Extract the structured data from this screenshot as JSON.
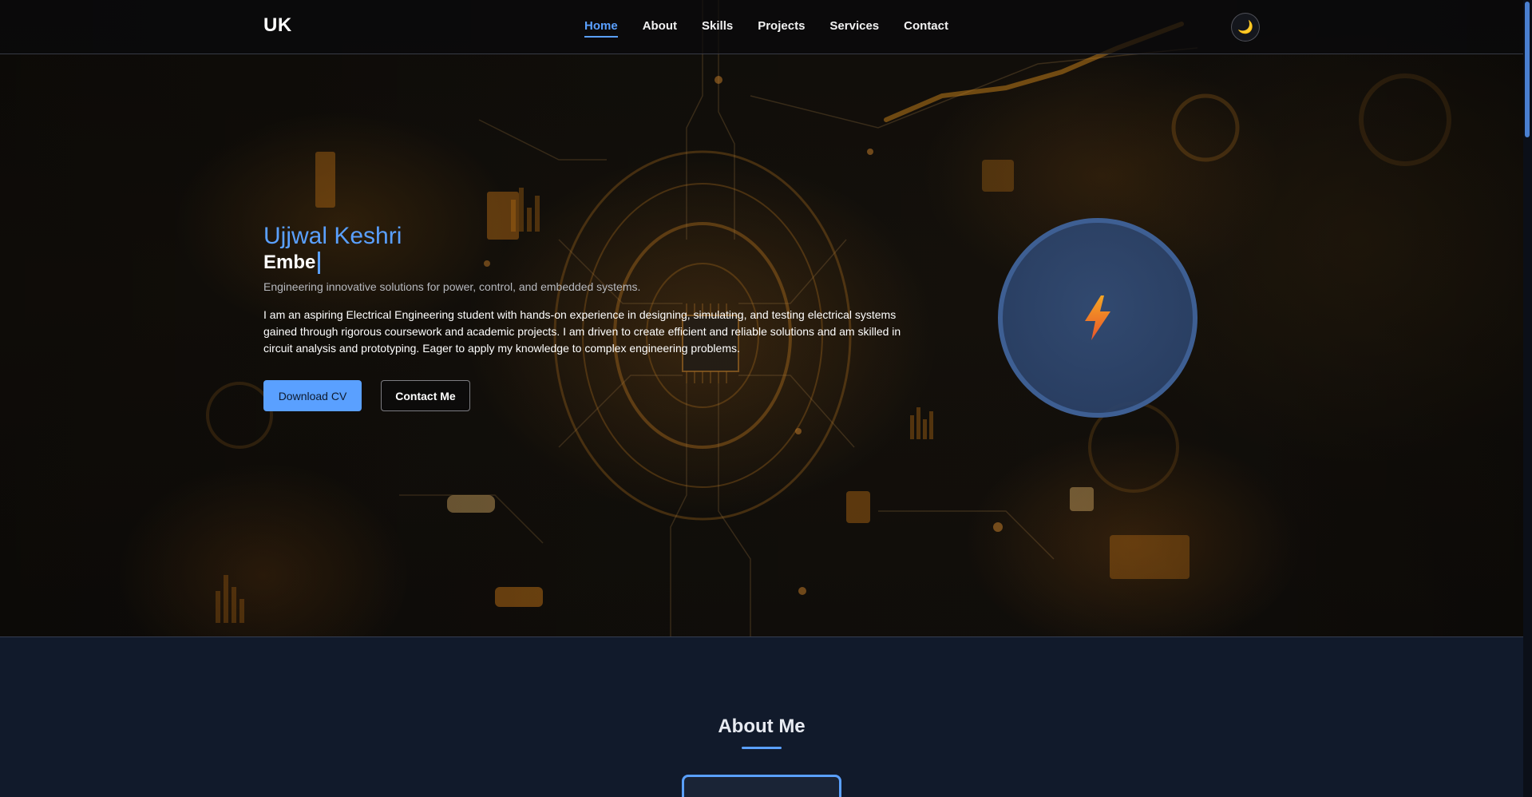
{
  "nav": {
    "logo": "UK",
    "links": [
      {
        "label": "Home",
        "active": true
      },
      {
        "label": "About"
      },
      {
        "label": "Skills"
      },
      {
        "label": "Projects"
      },
      {
        "label": "Services"
      },
      {
        "label": "Contact"
      }
    ],
    "theme_icon": "moon-icon"
  },
  "hero": {
    "name": "Ujjwal Keshri",
    "role_typing": "Embe",
    "tagline": "Engineering innovative solutions for power, control, and embedded systems.",
    "bio": "I am an aspiring Electrical Engineering student with hands-on experience in designing, simulating, and testing electrical systems gained through rigorous coursework and academic projects. I am driven to create efficient and reliable solutions and am skilled in circuit analysis and prototyping. Eager to apply my knowledge to complex engineering problems.",
    "download_cv": "Download CV",
    "contact_me": "Contact Me",
    "circle_icon": "lightning-bolt-icon"
  },
  "about": {
    "title": "About Me"
  },
  "colors": {
    "accent": "#5aa0ff",
    "background": "#111a2b",
    "bolt_top": "#f5a623",
    "bolt_bottom": "#e8552b"
  }
}
